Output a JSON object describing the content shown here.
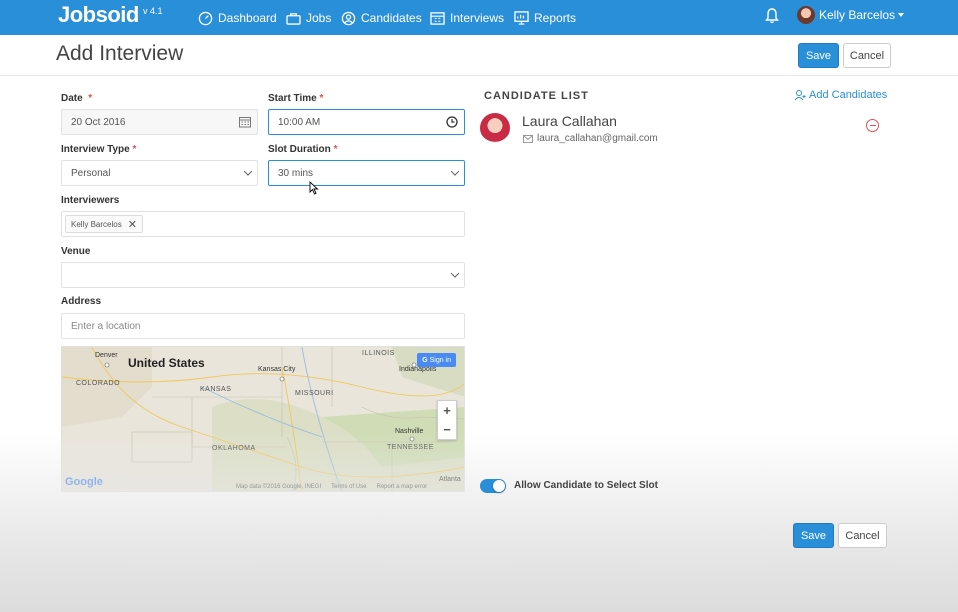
{
  "app": {
    "name": "Jobsoid",
    "version": "v 4.1"
  },
  "nav": {
    "items": [
      {
        "label": "Dashboard",
        "icon": "dashboard-icon"
      },
      {
        "label": "Jobs",
        "icon": "briefcase-icon"
      },
      {
        "label": "Candidates",
        "icon": "candidates-icon"
      },
      {
        "label": "Interviews",
        "icon": "calendar-icon"
      },
      {
        "label": "Reports",
        "icon": "reports-icon"
      }
    ],
    "user_name": "Kelly Barcelos"
  },
  "header": {
    "title": "Add Interview",
    "save_label": "Save",
    "cancel_label": "Cancel"
  },
  "form": {
    "date": {
      "label": "Date",
      "required": "*",
      "value": "20 Oct 2016"
    },
    "start_time": {
      "label": "Start Time",
      "required": "*",
      "value": "10:00 AM"
    },
    "interview_type": {
      "label": "Interview Type",
      "required": "*",
      "value": "Personal"
    },
    "slot_duration": {
      "label": "Slot Duration",
      "required": "*",
      "value": "30 mins"
    },
    "interviewers": {
      "label": "Interviewers",
      "tags": [
        "Kelly Barcelos"
      ]
    },
    "venue": {
      "label": "Venue",
      "value": ""
    },
    "address": {
      "label": "Address",
      "placeholder": "Enter a location"
    }
  },
  "map": {
    "title": "United States",
    "labels": {
      "denver": "Denver",
      "colorado": "COLORADO",
      "kansas_city": "Kansas City",
      "kansas": "KANSAS",
      "missouri": "MISSOURI",
      "illinois": "ILLINOIS",
      "indianapolis": "Indianapolis",
      "oklahoma": "OKLAHOMA",
      "nashville": "Nashville",
      "tennessee": "TENNESSEE",
      "atlanta": "Atlanta"
    },
    "sign_in": "Sign in",
    "footer": {
      "map_data": "Map data ©2016 Google, INEGI",
      "terms": "Terms of Use",
      "report": "Report a map error"
    },
    "google": "Google"
  },
  "candidates": {
    "title": "CANDIDATE LIST",
    "add_label": "Add Candidates",
    "items": [
      {
        "name": "Laura Callahan",
        "email": "laura_callahan@gmail.com"
      }
    ]
  },
  "settings": {
    "allow_slot_label": "Allow Candidate to Select Slot",
    "allow_slot_enabled": true
  },
  "footer": {
    "save_label": "Save",
    "cancel_label": "Cancel"
  },
  "colors": {
    "primary": "#2a8fd9",
    "danger": "#e05050"
  }
}
